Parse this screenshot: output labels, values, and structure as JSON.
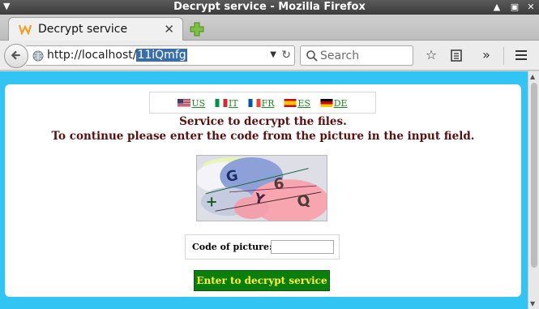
{
  "window": {
    "title": "Decrypt service - Mozilla Firefox"
  },
  "tabs": [
    {
      "title": "Decrypt service"
    }
  ],
  "navbar": {
    "url_host": "http://localhost/",
    "url_selected": "11iQmfg",
    "search_placeholder": "Search"
  },
  "languages": [
    {
      "code": "US",
      "label": "US"
    },
    {
      "code": "IT",
      "label": "IT"
    },
    {
      "code": "FR",
      "label": "FR"
    },
    {
      "code": "ES",
      "label": "ES"
    },
    {
      "code": "DE",
      "label": "DE"
    }
  ],
  "content": {
    "line1": "Service to decrypt the files.",
    "line2": "To continue please enter the code from the picture in the input field.",
    "captcha_chars": [
      "+",
      "G",
      "Y",
      "6",
      "Q"
    ],
    "code_label": "Code of picture:",
    "code_value": "",
    "submit_label": "Enter to decrypt service"
  },
  "colors": {
    "page_bg": "#32c4f2",
    "heading": "#5a0f0f",
    "link": "#1a8a1a",
    "submit_bg": "#0b7f0b",
    "submit_text": "#fff23a"
  }
}
